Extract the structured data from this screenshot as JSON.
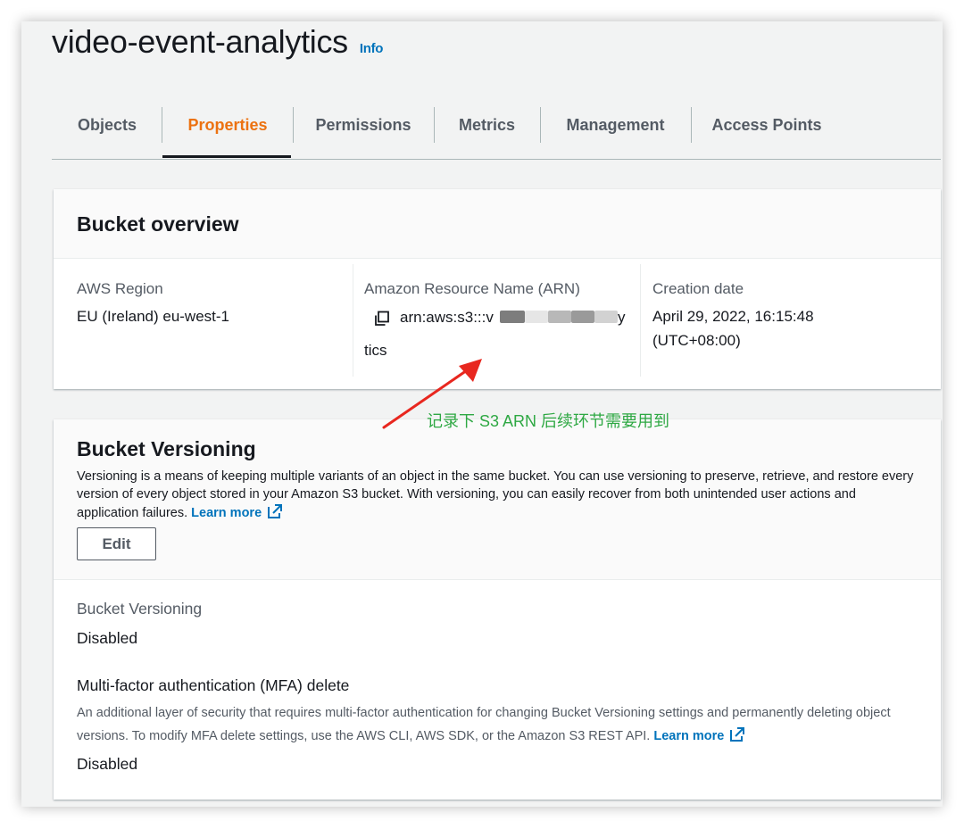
{
  "header": {
    "bucket_name": "video-event-analytics",
    "info_label": "Info"
  },
  "tabs": [
    {
      "label": "Objects",
      "active": false
    },
    {
      "label": "Properties",
      "active": true
    },
    {
      "label": "Permissions",
      "active": false
    },
    {
      "label": "Metrics",
      "active": false
    },
    {
      "label": "Management",
      "active": false
    },
    {
      "label": "Access Points",
      "active": false
    }
  ],
  "overview": {
    "title": "Bucket overview",
    "region_label": "AWS Region",
    "region_value": "EU (Ireland) eu-west-1",
    "arn_label": "Amazon Resource Name (ARN)",
    "arn_prefix": "arn:aws:s3:::v",
    "arn_suffix_1": "y",
    "arn_suffix_2": "tics",
    "creation_label": "Creation date",
    "creation_line1": "April 29, 2022, 16:15:48",
    "creation_line2": "(UTC+08:00)"
  },
  "annotation": {
    "text": "记录下 S3 ARN 后续环节需要用到",
    "color": "#2ea843",
    "arrow_color": "#e8271f"
  },
  "versioning": {
    "title": "Bucket Versioning",
    "description": "Versioning is a means of keeping multiple variants of an object in the same bucket. You can use versioning to preserve, retrieve, and restore every version of every object stored in your Amazon S3 bucket. With versioning, you can easily recover from both unintended user actions and application failures.",
    "learn_more": "Learn more",
    "edit_label": "Edit",
    "status_label": "Bucket Versioning",
    "status_value": "Disabled",
    "mfa_label": "Multi-factor authentication (MFA) delete",
    "mfa_description": "An additional layer of security that requires multi-factor authentication for changing Bucket Versioning settings and permanently deleting object versions. To modify MFA delete settings, use the AWS CLI, AWS SDK, or the Amazon S3 REST API.",
    "mfa_learn_more": "Learn more",
    "mfa_value": "Disabled"
  },
  "colors": {
    "accent_orange": "#ec7211",
    "link_blue": "#0073bb",
    "text_dark": "#16191f",
    "text_muted": "#545b64"
  }
}
